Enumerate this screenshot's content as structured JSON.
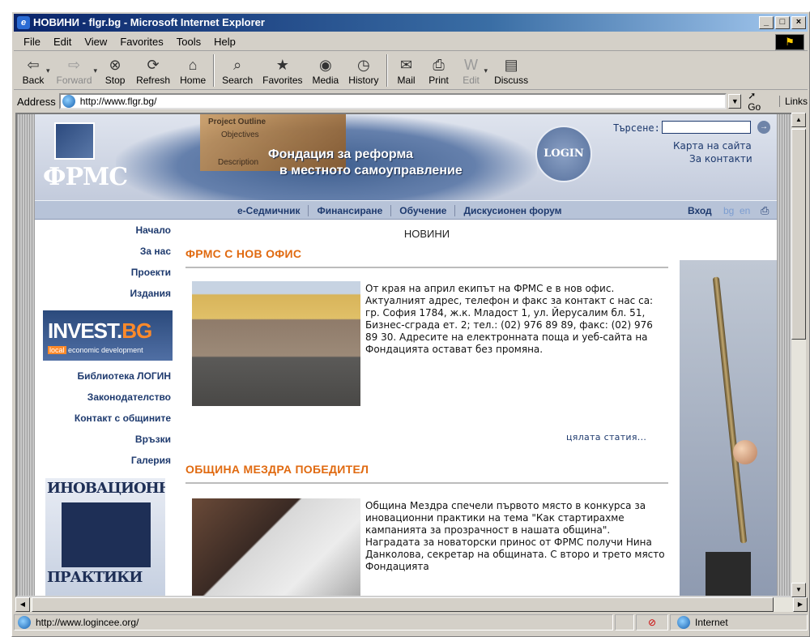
{
  "window": {
    "title": "НОВИНИ - flgr.bg - Microsoft Internet Explorer",
    "controls": [
      "_",
      "□",
      "×"
    ]
  },
  "menu": [
    "File",
    "Edit",
    "View",
    "Favorites",
    "Tools",
    "Help"
  ],
  "toolbar": {
    "buttons": [
      {
        "label": "Back",
        "icon": "back-arrow-icon",
        "glyph": "⇦",
        "enabled": true
      },
      {
        "label": "Forward",
        "icon": "forward-arrow-icon",
        "glyph": "⇨",
        "enabled": false
      },
      {
        "label": "Stop",
        "icon": "stop-icon",
        "glyph": "⊗",
        "enabled": true
      },
      {
        "label": "Refresh",
        "icon": "refresh-icon",
        "glyph": "⟳",
        "enabled": true
      },
      {
        "label": "Home",
        "icon": "home-icon",
        "glyph": "⌂",
        "enabled": true
      },
      {
        "label": "Search",
        "icon": "search-icon",
        "glyph": "⌕",
        "enabled": true
      },
      {
        "label": "Favorites",
        "icon": "favorites-icon",
        "glyph": "★",
        "enabled": true
      },
      {
        "label": "Media",
        "icon": "media-icon",
        "glyph": "◉",
        "enabled": true
      },
      {
        "label": "History",
        "icon": "history-icon",
        "glyph": "◷",
        "enabled": true
      },
      {
        "label": "Mail",
        "icon": "mail-icon",
        "glyph": "✉",
        "enabled": true
      },
      {
        "label": "Print",
        "icon": "print-icon",
        "glyph": "⎙",
        "enabled": true
      },
      {
        "label": "Edit",
        "icon": "edit-icon",
        "glyph": "W",
        "enabled": false
      },
      {
        "label": "Discuss",
        "icon": "discuss-icon",
        "glyph": "▤",
        "enabled": true
      }
    ]
  },
  "address": {
    "label": "Address",
    "url": "http://www.flgr.bg/",
    "go": "Go",
    "links": "Links"
  },
  "site": {
    "logo": "ФРМС",
    "banner_photo_lines": [
      "Project Outline",
      "Objectives",
      "Description"
    ],
    "title_line1": "Фондация за реформа",
    "title_line2": "в местното самоуправление",
    "seal": "LOGIN",
    "search_label": "Търсене:",
    "search_go": "→",
    "sitemap": "Карта на сайта",
    "contacts": "За контакти",
    "nav": [
      "е-Седмичник",
      "Финансиране",
      "Обучение",
      "Дискусионен форум"
    ],
    "login": "Вход",
    "lang_bg": "bg",
    "lang_en": "en",
    "left_nav_top": [
      "Начало",
      "За нас",
      "Проекти",
      "Издания"
    ],
    "left_nav_bottom": [
      "Библиотека ЛОГИН",
      "Законодателство",
      "Контакт с общините",
      "Връзки",
      "Галерия"
    ],
    "invest_main": "INVEST.",
    "invest_bg": "BG",
    "invest_local": "local",
    "invest_sub": "economic development",
    "inov_top": "ИНОВАЦИОННИ",
    "inov_bottom": "ПРАКТИКИ",
    "page_heading": "НОВИНИ",
    "articles": [
      {
        "title": "ФРМС С НОВ ОФИС",
        "text": "От края на април екипът на ФРМС е в нов офис. Актуалният адрес, телефон и факс за контакт с нас са: гр. София 1784, ж.к. Младост 1, ул. Йерусалим бл. 51, Бизнес-сграда ет. 2; тел.: (02) 976 89 89, факс: (02) 976 89 30. Адресите на електронната поща и уеб-сайта на Фондацията остават без промяна.",
        "more": "цялата статия..."
      },
      {
        "title": "ОБЩИНА МЕЗДРА ПОБЕДИТЕЛ",
        "text": "Община Мездра спечели първото място в конкурса за иновационни практики на тема \"Как стартирахме кампанията за прозрачност в нашата община\". Наградата за новаторски принос от ФРМС получи Нина Данколова, секретар на общината. С второ и трето място Фондацията",
        "more": ""
      }
    ]
  },
  "status": {
    "text": "http://www.logincee.org/",
    "zone": "Internet"
  }
}
